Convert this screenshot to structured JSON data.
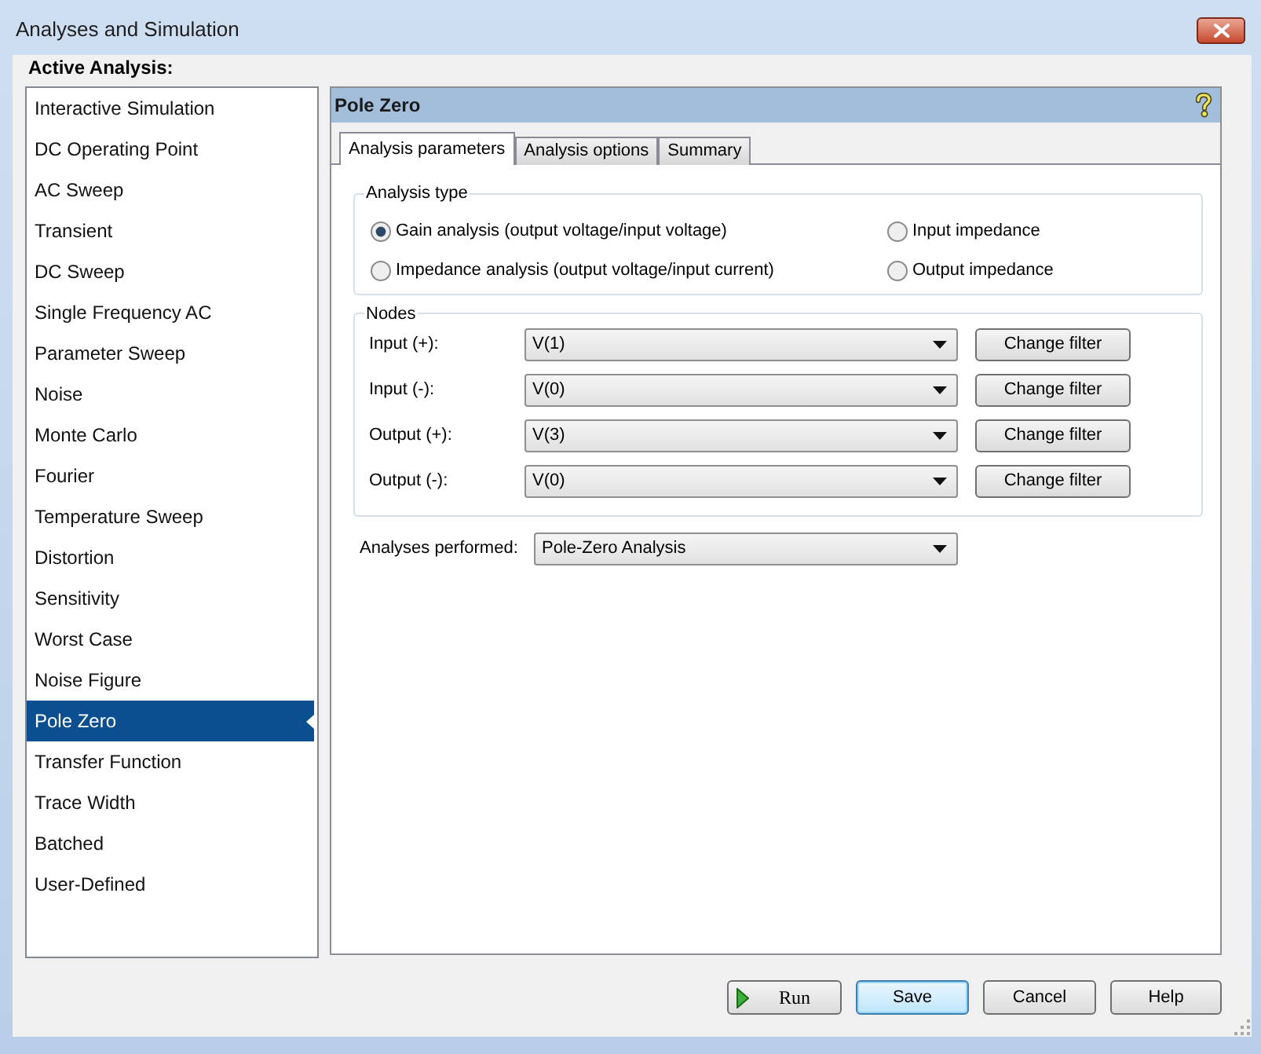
{
  "window": {
    "title": "Analyses and Simulation"
  },
  "sidebar": {
    "heading": "Active Analysis:",
    "items": [
      {
        "label": "Interactive Simulation",
        "selected": false
      },
      {
        "label": "DC Operating Point",
        "selected": false
      },
      {
        "label": "AC Sweep",
        "selected": false
      },
      {
        "label": "Transient",
        "selected": false
      },
      {
        "label": "DC Sweep",
        "selected": false
      },
      {
        "label": "Single Frequency AC",
        "selected": false
      },
      {
        "label": "Parameter Sweep",
        "selected": false
      },
      {
        "label": "Noise",
        "selected": false
      },
      {
        "label": "Monte Carlo",
        "selected": false
      },
      {
        "label": "Fourier",
        "selected": false
      },
      {
        "label": "Temperature Sweep",
        "selected": false
      },
      {
        "label": "Distortion",
        "selected": false
      },
      {
        "label": "Sensitivity",
        "selected": false
      },
      {
        "label": "Worst Case",
        "selected": false
      },
      {
        "label": "Noise Figure",
        "selected": false
      },
      {
        "label": "Pole Zero",
        "selected": true
      },
      {
        "label": "Transfer Function",
        "selected": false
      },
      {
        "label": "Trace Width",
        "selected": false
      },
      {
        "label": "Batched",
        "selected": false
      },
      {
        "label": "User-Defined",
        "selected": false
      }
    ]
  },
  "panel": {
    "title": "Pole Zero",
    "tabs": [
      {
        "label": "Analysis parameters",
        "selected": true
      },
      {
        "label": "Analysis options",
        "selected": false
      },
      {
        "label": "Summary",
        "selected": false
      }
    ],
    "analysis_type": {
      "legend": "Analysis type",
      "options": [
        {
          "label": "Gain analysis (output voltage/input voltage)",
          "selected": true
        },
        {
          "label": "Input impedance",
          "selected": false
        },
        {
          "label": "Impedance analysis (output voltage/input current)",
          "selected": false
        },
        {
          "label": "Output impedance",
          "selected": false
        }
      ]
    },
    "nodes": {
      "legend": "Nodes",
      "rows": [
        {
          "label": "Input (+):",
          "value": "V(1)",
          "button": "Change filter"
        },
        {
          "label": "Input (-):",
          "value": "V(0)",
          "button": "Change filter"
        },
        {
          "label": "Output (+):",
          "value": "V(3)",
          "button": "Change filter"
        },
        {
          "label": "Output (-):",
          "value": "V(0)",
          "button": "Change filter"
        }
      ]
    },
    "analyses_performed": {
      "label": "Analyses performed:",
      "value": "Pole-Zero Analysis"
    }
  },
  "buttons": [
    {
      "label": "Run",
      "kind": "run"
    },
    {
      "label": "Save",
      "kind": "default"
    },
    {
      "label": "Cancel",
      "kind": "normal"
    },
    {
      "label": "Help",
      "kind": "normal"
    }
  ]
}
